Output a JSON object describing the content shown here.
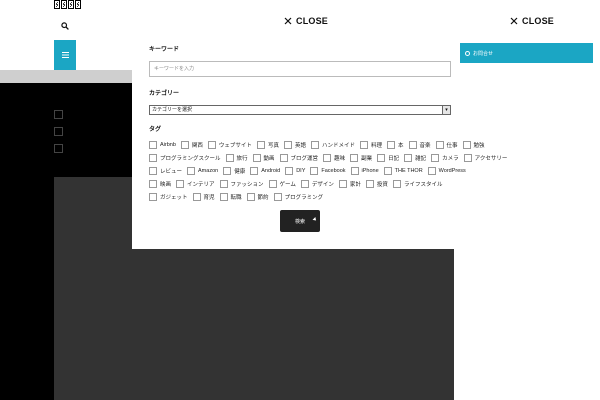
{
  "header": {
    "logo_text": "XXXX"
  },
  "overlay": {
    "close_label": "CLOSE",
    "keyword_label": "キーワード",
    "keyword_placeholder": "キーワードを入力",
    "category_label": "カテゴリー",
    "category_selected": "カテゴリーを選択",
    "tag_label": "タグ",
    "submit_label": "検索",
    "tags": [
      [
        "Airbnb",
        "関西",
        "ウェブサイト",
        "写真",
        "英語",
        "ハンドメイド",
        "料理",
        "本",
        "音楽",
        "仕事",
        "勉強"
      ],
      [
        "プログラミングスクール",
        "旅行",
        "動画",
        "ブログ運営",
        "趣味",
        "副業",
        "日記",
        "雑記",
        "カメラ",
        "アクセサリー"
      ],
      [
        "レビュー",
        "Amazon",
        "健康",
        "Android",
        "DIY",
        "Facebook",
        "iPhone",
        "THE THOR",
        "WordPress"
      ],
      [
        "映画",
        "インテリア",
        "ファッション",
        "ゲーム",
        "デザイン",
        "家計",
        "投資",
        "ライフスタイル"
      ],
      [
        "ガジェット",
        "育児",
        "転職",
        "節約",
        "プログラミング"
      ]
    ]
  },
  "right_panel": {
    "close_label": "CLOSE",
    "cta_label": "お問合せ"
  },
  "colors": {
    "accent": "#1ba6c4",
    "dark": "#333333",
    "black": "#000000"
  }
}
